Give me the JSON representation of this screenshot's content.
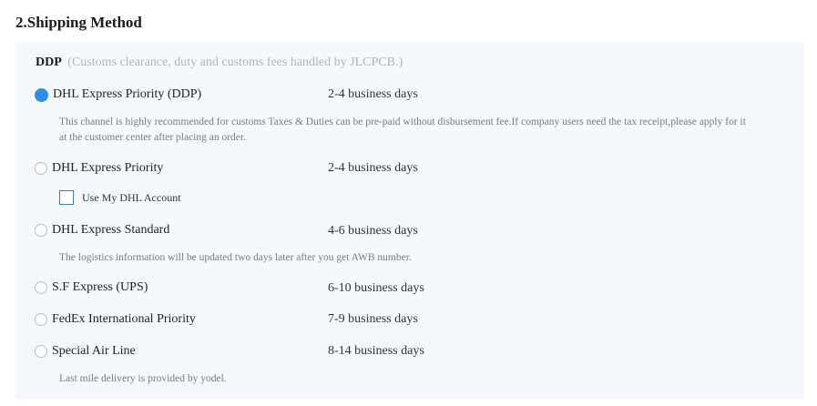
{
  "section": {
    "title": "2.Shipping Method"
  },
  "ddp": {
    "label": "DDP",
    "note": "(Customs clearance, duty and customs fees handled by JLCPCB.)"
  },
  "options": [
    {
      "label": "DHL Express Priority (DDP)",
      "days": "2-4 business days",
      "selected": true,
      "description": "This channel is highly recommended for customs Taxes & Duties can be pre-paid without disbursement fee.If company users need the tax receipt,please apply for it at the customer center after placing an order."
    },
    {
      "label": "DHL Express Priority",
      "days": "2-4 business days",
      "selected": false,
      "checkbox_label": "Use My DHL Account"
    },
    {
      "label": "DHL Express Standard",
      "days": "4-6 business days",
      "selected": false,
      "description": "The logistics information will be updated two days later after you get AWB number."
    },
    {
      "label": "S.F Express (UPS)",
      "days": "6-10 business days",
      "selected": false
    },
    {
      "label": "FedEx International Priority",
      "days": "7-9 business days",
      "selected": false
    },
    {
      "label": "Special Air Line",
      "days": "8-14 business days",
      "selected": false,
      "description": "Last mile delivery is provided by yodel."
    }
  ],
  "colors": {
    "accent": "#2d8ee8",
    "panel_bg": "#f5f9fd",
    "muted_text": "#7a7a7a",
    "note_text": "#b3b3b3"
  }
}
